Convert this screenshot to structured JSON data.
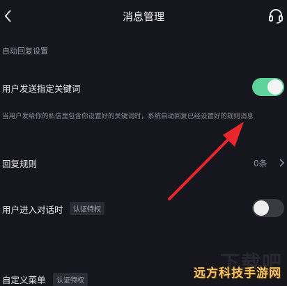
{
  "header": {
    "title": "消息管理",
    "back_icon": "chevron-left-icon",
    "support_icon": "headset-icon"
  },
  "auto_reply": {
    "section_title": "自动回复设置",
    "keyword_label": "用户发送指定关键词",
    "keyword_enabled": true,
    "keyword_desc": "当用户发给你的私信里包含你设置好的关键词时，系统自动回复已经设置好的规则消息",
    "rules_label": "回复规则",
    "rules_count": "0条",
    "chat_enter_label": "用户进入对话时",
    "chat_enter_badge": "认证特权",
    "chat_enter_enabled": false,
    "custom_menu_label": "自定义菜单",
    "custom_menu_badge": "认证特权"
  },
  "watermark": {
    "faint_text": "下载吧",
    "overlay_text": "远方科技手游网"
  },
  "colors": {
    "background": "#16161e",
    "toggle_on": "#5fd49a",
    "arrow": "#e8262b"
  }
}
